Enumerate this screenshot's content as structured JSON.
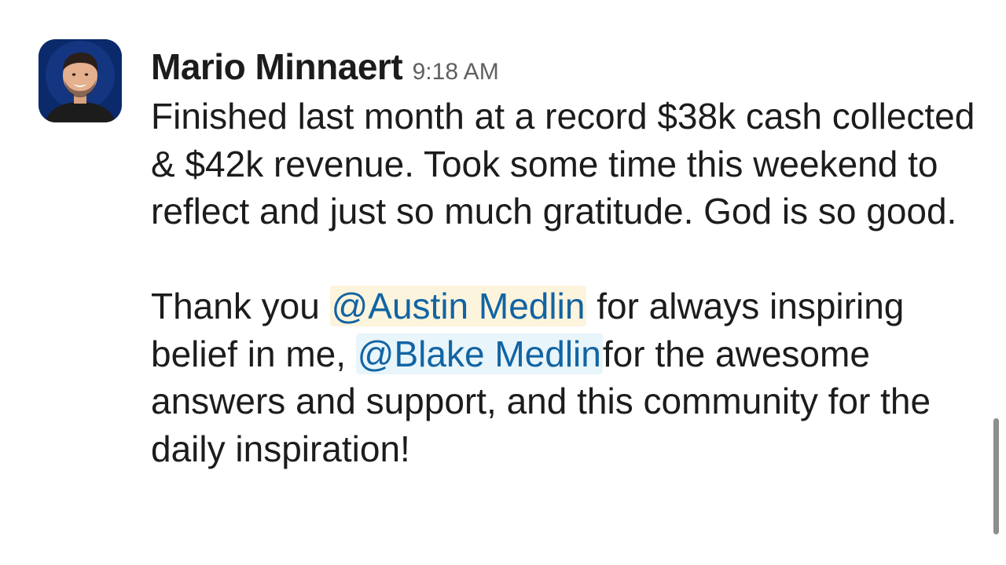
{
  "message": {
    "author": "Mario Minnaert",
    "timestamp": "9:18 AM",
    "paragraph1": "Finished last month at a record $38k cash collected & $42k revenue. Took some time this weekend to reflect and just so much gratitude. God is so good.",
    "paragraph2": {
      "part1": "Thank you ",
      "mention1": "@Austin Medlin",
      "part2": " for always inspiring belief in me, ",
      "mention2": "@Blake Medlin",
      "part3": "for the awesome answers and support, and this community for the daily inspiration!"
    }
  },
  "colors": {
    "mention_text": "#1264a3",
    "mention1_bg": "#fcf4dc",
    "mention2_bg": "#e8f5fa",
    "timestamp": "#616061",
    "avatar_bg": "#0b2a6b"
  },
  "icons": {
    "avatar": "user-avatar-photo"
  }
}
